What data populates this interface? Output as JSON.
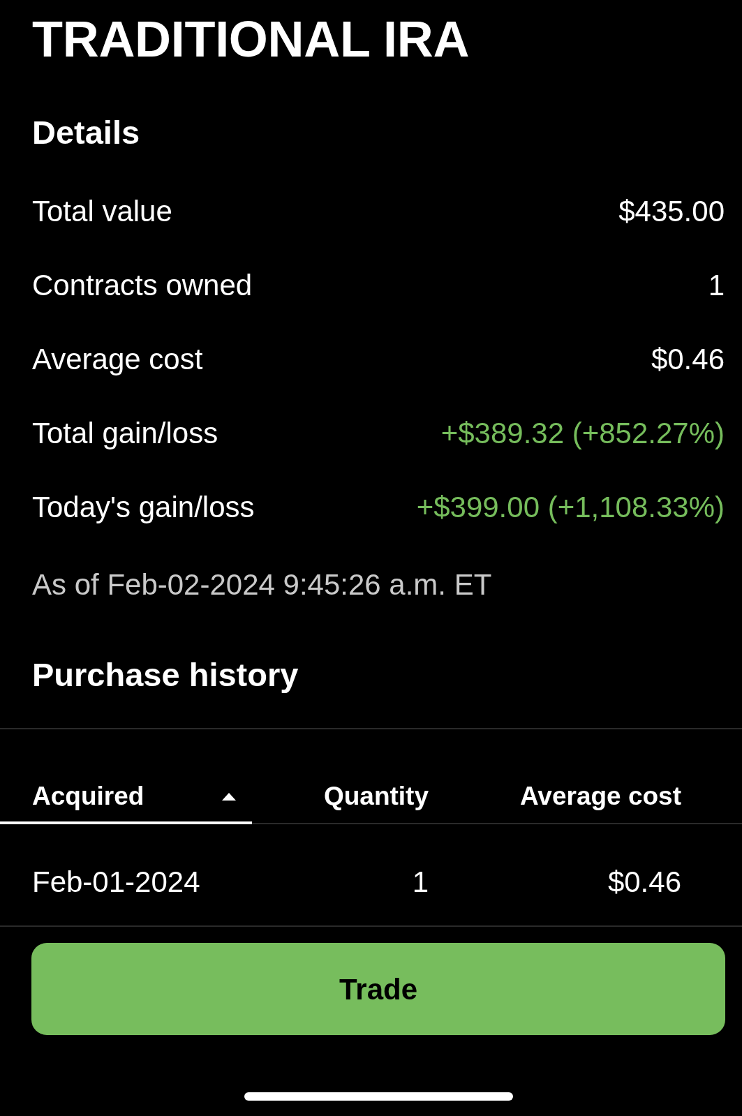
{
  "title": "TRADITIONAL IRA",
  "details": {
    "heading": "Details",
    "rows": [
      {
        "label": "Total value",
        "value": "$435.00",
        "kind": "plain"
      },
      {
        "label": "Contracts owned",
        "value": "1",
        "kind": "plain"
      },
      {
        "label": "Average cost",
        "value": "$0.46",
        "kind": "plain"
      },
      {
        "label": "Total gain/loss",
        "value": "+$389.32 (+852.27%)",
        "kind": "gain"
      },
      {
        "label": "Today's gain/loss",
        "value": "+$399.00 (+1,108.33%)",
        "kind": "gain"
      }
    ],
    "as_of": "As of Feb-02-2024 9:45:26 a.m. ET"
  },
  "purchase_history": {
    "heading": "Purchase history",
    "table": {
      "columns": [
        {
          "label": "Acquired",
          "selected": true,
          "sort_ascending": true
        },
        {
          "label": "Quantity",
          "selected": false
        },
        {
          "label": "Average cost",
          "selected": false
        }
      ],
      "rows": [
        [
          "Feb-01-2024",
          "1",
          "$0.46"
        ]
      ]
    }
  },
  "trade_button": {
    "label": "Trade"
  }
}
